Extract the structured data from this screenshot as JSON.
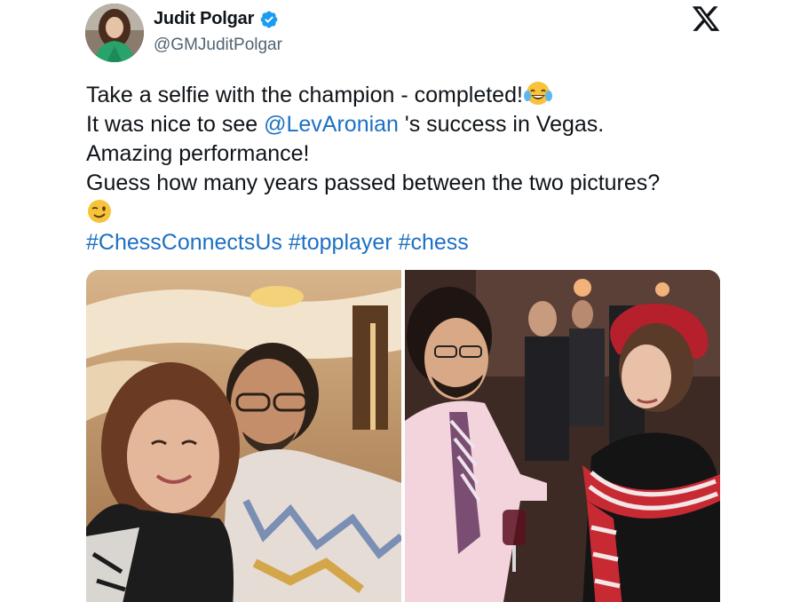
{
  "author": {
    "display_name": "Judit Polgar",
    "handle": "@GMJuditPolgar",
    "verified": true,
    "avatar_icon": "avatar-photo"
  },
  "platform_icon": "x-logo-icon",
  "post": {
    "line1": "Take a selfie with the champion - completed!",
    "line1_emoji": "tears-of-joy-emoji",
    "line2_mention": "@LevAronian",
    "line2_rest": " 's success in Vegas.",
    "line2_prefix": "It was nice to see ",
    "line3": "Amazing performance!",
    "line4": "Guess how many years passed between the two pictures?",
    "line5_emoji": "winking-face-emoji",
    "hashtags": [
      "#ChessConnectsUs",
      "#topplayer",
      "#chess"
    ]
  },
  "media": {
    "photos": [
      {
        "name": "selfie-photo-vegas"
      },
      {
        "name": "older-event-photo"
      }
    ]
  },
  "colors": {
    "link": "#1d70c2",
    "verified": "#1d9bf0",
    "text": "#0f1419",
    "secondary": "#536471"
  }
}
